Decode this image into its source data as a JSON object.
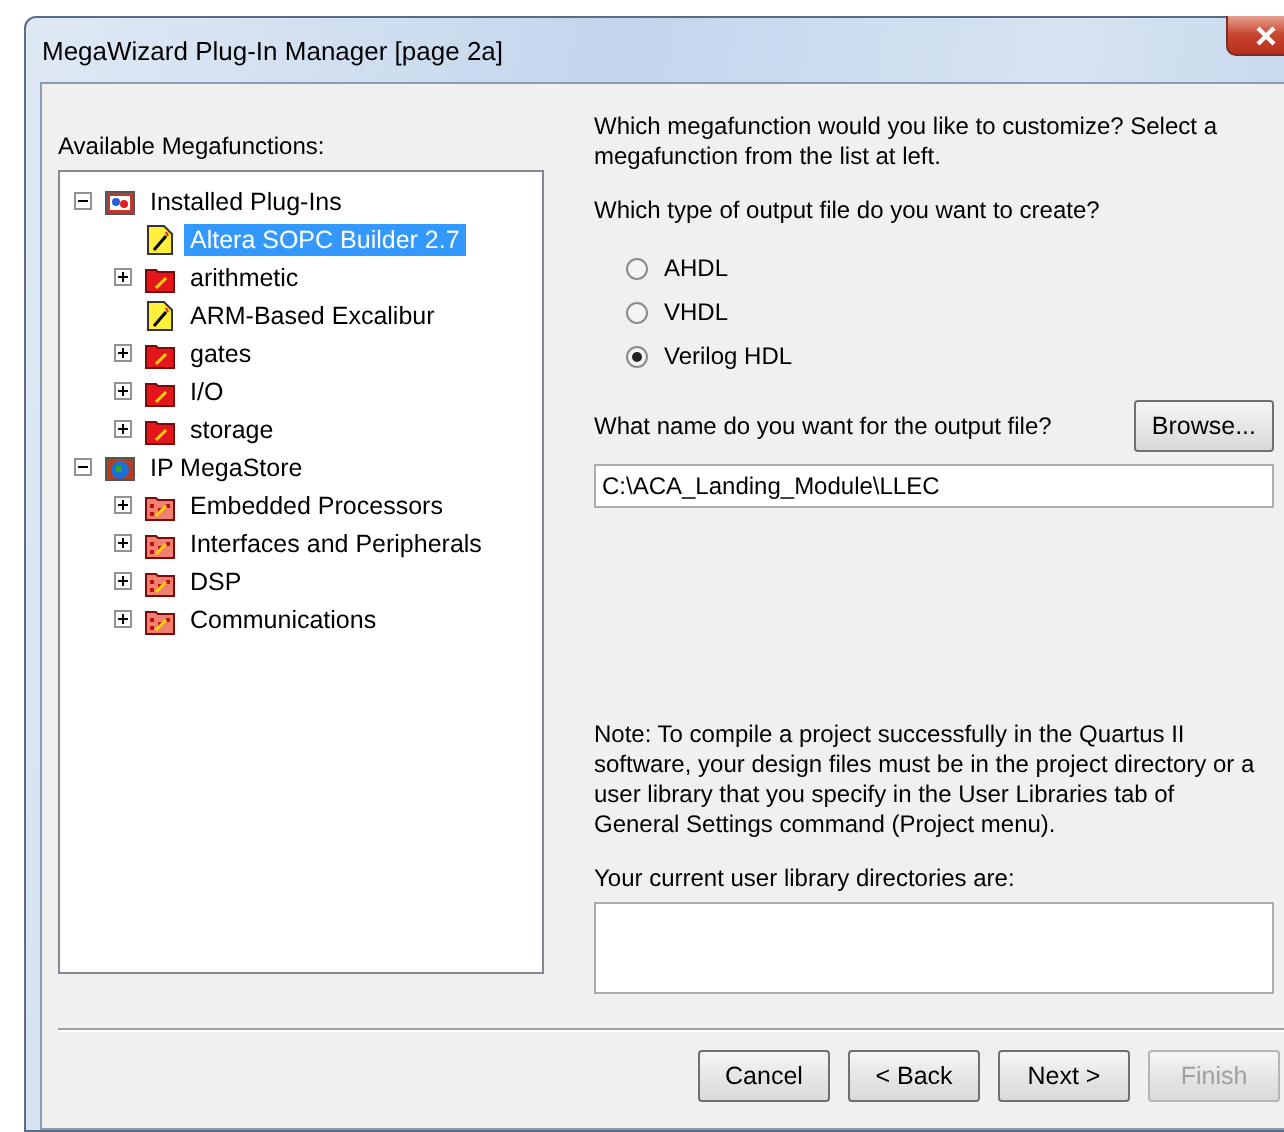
{
  "window": {
    "title": "MegaWizard Plug-In Manager [page 2a]"
  },
  "tree": {
    "label": "Available Megafunctions:",
    "items": [
      {
        "label": "Installed Plug-Ins",
        "kind": "installed",
        "expanded": true,
        "selected": false,
        "children": [
          {
            "label": "Altera SOPC Builder 2.7",
            "kind": "plugin",
            "selected": true
          },
          {
            "label": "arithmetic",
            "kind": "folder",
            "expanded": false,
            "selected": false
          },
          {
            "label": "ARM-Based Excalibur",
            "kind": "plugin",
            "selected": false
          },
          {
            "label": "gates",
            "kind": "folder",
            "expanded": false,
            "selected": false
          },
          {
            "label": "I/O",
            "kind": "folder",
            "expanded": false,
            "selected": false
          },
          {
            "label": "storage",
            "kind": "folder",
            "expanded": false,
            "selected": false
          }
        ]
      },
      {
        "label": "IP MegaStore",
        "kind": "store",
        "expanded": true,
        "selected": false,
        "children": [
          {
            "label": "Embedded Processors",
            "kind": "store-folder",
            "expanded": false,
            "selected": false
          },
          {
            "label": "Interfaces and Peripherals",
            "kind": "store-folder",
            "expanded": false,
            "selected": false
          },
          {
            "label": "DSP",
            "kind": "store-folder",
            "expanded": false,
            "selected": false
          },
          {
            "label": "Communications",
            "kind": "store-folder",
            "expanded": false,
            "selected": false
          }
        ]
      }
    ]
  },
  "prompt": "Which megafunction would you like to customize? Select a megafunction from the list at left.",
  "output_type": {
    "label": "Which type of output file do you want to create?",
    "options": [
      {
        "label": "AHDL",
        "selected": false
      },
      {
        "label": "VHDL",
        "selected": false
      },
      {
        "label": "Verilog HDL",
        "selected": true
      }
    ]
  },
  "output_file": {
    "label": "What name do you want for the output file?",
    "browse": "Browse...",
    "value": "C:\\ACA_Landing_Module\\LLEC"
  },
  "note": "Note: To compile a project successfully in the Quartus II software, your design files must be in the project directory or a user library that you specify in the User Libraries tab of General Settings command (Project menu).",
  "libraries_label": "Your current user library directories are:",
  "buttons": [
    {
      "label": "Cancel",
      "disabled": false
    },
    {
      "label": "< Back",
      "disabled": false
    },
    {
      "label": "Next >",
      "disabled": false
    },
    {
      "label": "Finish",
      "disabled": true
    }
  ]
}
